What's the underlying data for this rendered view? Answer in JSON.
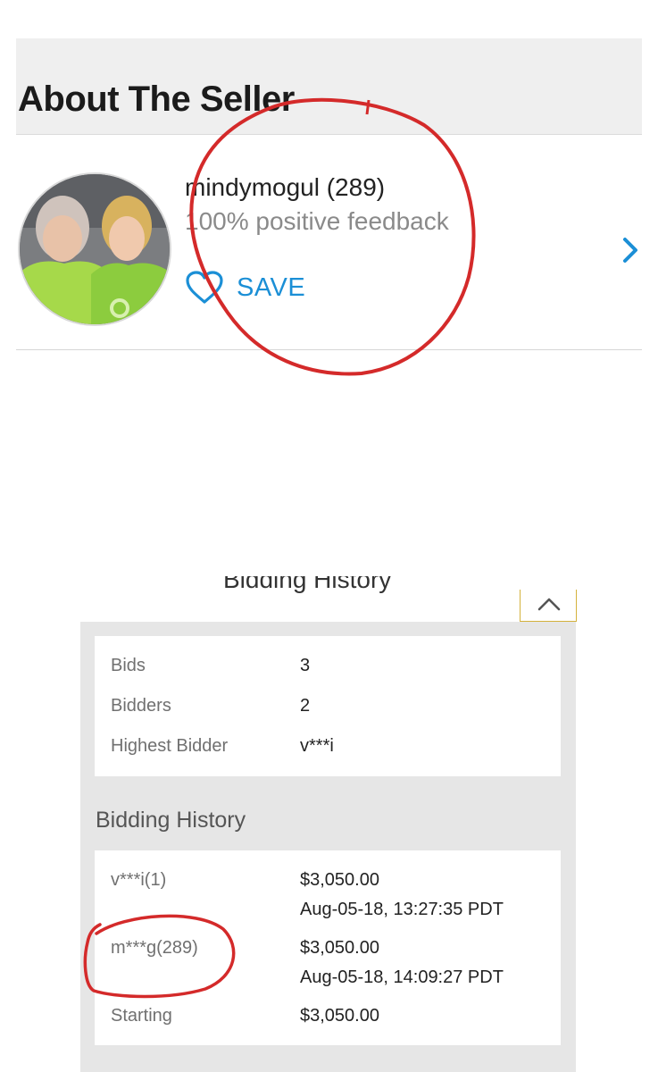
{
  "seller": {
    "section_title": "About The Seller",
    "name": "mindymogul (289)",
    "feedback": "100% positive feedback",
    "save_label": "SAVE"
  },
  "bidding": {
    "top_title": "Bidding History",
    "summary": [
      {
        "label": "Bids",
        "value": "3"
      },
      {
        "label": "Bidders",
        "value": "2"
      },
      {
        "label": "Highest Bidder",
        "value": "v***i"
      }
    ],
    "history_title": "Bidding History",
    "history": [
      {
        "bidder": "v***i(1)",
        "amount": "$3,050.00",
        "time": "Aug-05-18, 13:27:35 PDT"
      },
      {
        "bidder": "m***g(289)",
        "amount": "$3,050.00",
        "time": "Aug-05-18, 14:09:27 PDT"
      },
      {
        "bidder": "Starting",
        "amount": "$3,050.00",
        "time": ""
      }
    ]
  },
  "colors": {
    "accent_blue": "#1b8fd6",
    "annotation_red": "#d42a2a",
    "collapse_border": "#d4b23c"
  }
}
